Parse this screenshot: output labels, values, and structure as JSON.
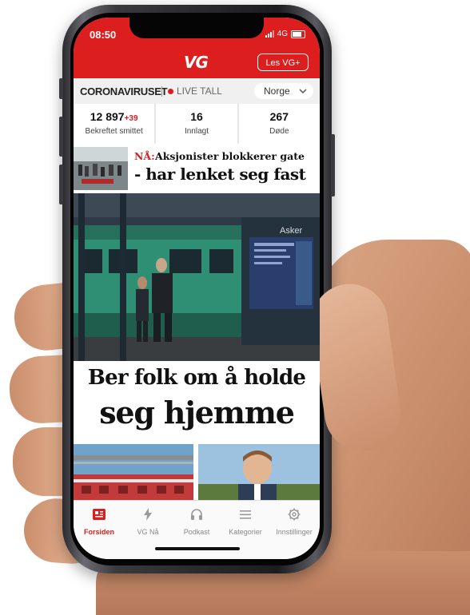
{
  "status_bar": {
    "time": "08:50",
    "network": "4G"
  },
  "header": {
    "logo": "VG",
    "cta_label": "Les VG+"
  },
  "corona": {
    "title": "CORONAVIRUSET",
    "live_label": "LIVE TALL",
    "country": "Norge",
    "stats": [
      {
        "value": "12 897",
        "delta": "+39",
        "label": "Bekreftet smittet"
      },
      {
        "value": "16",
        "delta": "",
        "label": "Innlagt"
      },
      {
        "value": "267",
        "delta": "",
        "label": "Døde"
      }
    ]
  },
  "news_item": {
    "prefix": "NÅ:",
    "line1": "Aksjonister blokkerer gate",
    "line2": "- har lenket seg fast"
  },
  "hero": {
    "station_sign": "Asker",
    "headline_line1": "Ber folk om å holde",
    "headline_line2": "seg hjemme"
  },
  "tabbar": {
    "tabs": [
      {
        "label": "Forsiden",
        "icon": "newspaper-icon",
        "active": true
      },
      {
        "label": "VG Nå",
        "icon": "lightning-icon",
        "active": false
      },
      {
        "label": "Podkast",
        "icon": "headphones-icon",
        "active": false
      },
      {
        "label": "Kategorier",
        "icon": "menu-icon",
        "active": false
      },
      {
        "label": "Innstillinger",
        "icon": "gear-icon",
        "active": false
      }
    ]
  },
  "colors": {
    "brand_red": "#dd1e1e",
    "train_green": "#2f8f74"
  }
}
